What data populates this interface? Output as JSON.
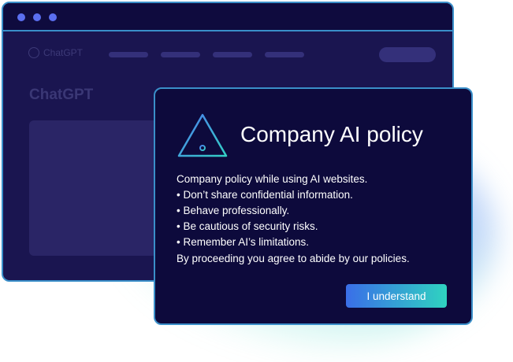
{
  "browser": {
    "logo_text": "ChatGPT",
    "heading": "ChatGPT"
  },
  "dialog": {
    "icon": "warning-triangle-icon",
    "title": "Company AI policy",
    "intro": "Company policy while using AI websites.",
    "rules": [
      "• Don’t share confidential information.",
      "• Behave professionally.",
      "• Be cautious of security risks.",
      "• Remember AI’s limitations."
    ],
    "footer": "By proceeding you agree to abide by our policies.",
    "button_label": "I understand"
  },
  "colors": {
    "accent_border": "#3a8fc9",
    "dialog_bg": "#0d0a3c",
    "browser_bg": "#1a1550",
    "button_gradient_start": "#3a6ee8",
    "button_gradient_end": "#2fd3c0"
  }
}
